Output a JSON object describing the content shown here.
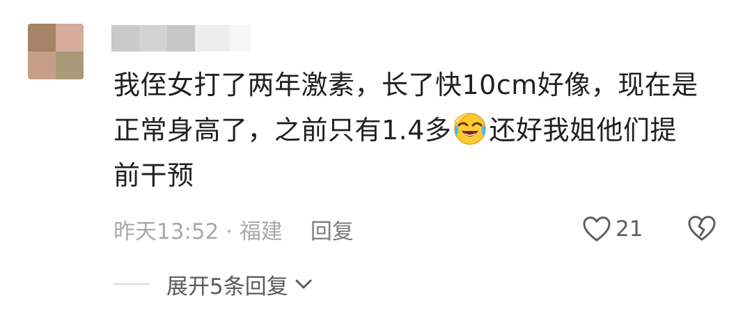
{
  "comment": {
    "lines": [
      "我侄女打了两年激素，长了快10cm好像，现在是",
      "正常身高了，之前只有1.4多",
      "还好我姐他们提",
      "前干预"
    ],
    "emoji": "laughing-crying-emoji"
  },
  "meta": {
    "time_location": "昨天13:52 · 福建",
    "reply_label": "回复"
  },
  "like": {
    "count": "21"
  },
  "expand": {
    "label": "展开5条回复"
  },
  "icons": {
    "like": "heart-outline-icon",
    "dislike": "broken-heart-icon",
    "expand": "chevron-down-icon"
  }
}
